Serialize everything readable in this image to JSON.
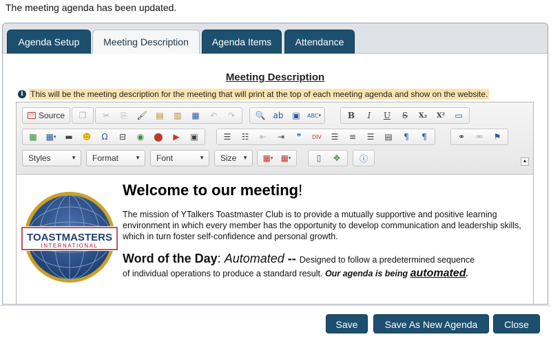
{
  "status_message": "The meeting agenda has been updated.",
  "tabs": [
    {
      "label": "Agenda Setup",
      "active": false
    },
    {
      "label": "Meeting Description",
      "active": true
    },
    {
      "label": "Agenda Items",
      "active": false
    },
    {
      "label": "Attendance",
      "active": false
    }
  ],
  "section_title": "Meeting Description",
  "info_text": "This will be the meeting description for the meeting that will print at the top of each meeting agenda and show on the website.",
  "toolbar": {
    "source_label": "Source",
    "styles_label": "Styles",
    "format_label": "Format",
    "font_label": "Font",
    "size_label": "Size",
    "bold": "B",
    "italic": "I",
    "underline": "U",
    "strike": "S",
    "subscript": "X₂",
    "superscript": "X²",
    "spellcheck": "ABC",
    "omega": "Ω"
  },
  "content": {
    "welcome_text": "Welcome to our meeting",
    "welcome_bang": "!",
    "mission": "The mission of YTalkers Toastmaster Club is to provide a mutually supportive and positive learning environment in which every member has the opportunity to develop communication and leadership skills, which in turn foster self-confidence and personal growth.",
    "wotd_label": "Word of the Day",
    "wotd_colon": ": ",
    "wotd_word": "Automated",
    "wotd_dash": " -- ",
    "wotd_def1": "Designed to follow a predetermined sequence",
    "wotd_def2": "of individual operations to produce a standard result. ",
    "agenda_phrase": "Our agenda is being ",
    "agenda_word": "automated",
    "agenda_end": "."
  },
  "logo": {
    "brand": "TOASTMASTERS",
    "sub": "INTERNATIONAL"
  },
  "buttons": {
    "save": "Save",
    "save_as_new": "Save As New Agenda",
    "close": "Close"
  },
  "colors": {
    "tab_bg": "#1d4f6f",
    "button_bg": "#1d4f6f",
    "info_highlight": "#fbe3b0",
    "logo_red": "#a51c30",
    "logo_blue": "#1f3f73"
  }
}
